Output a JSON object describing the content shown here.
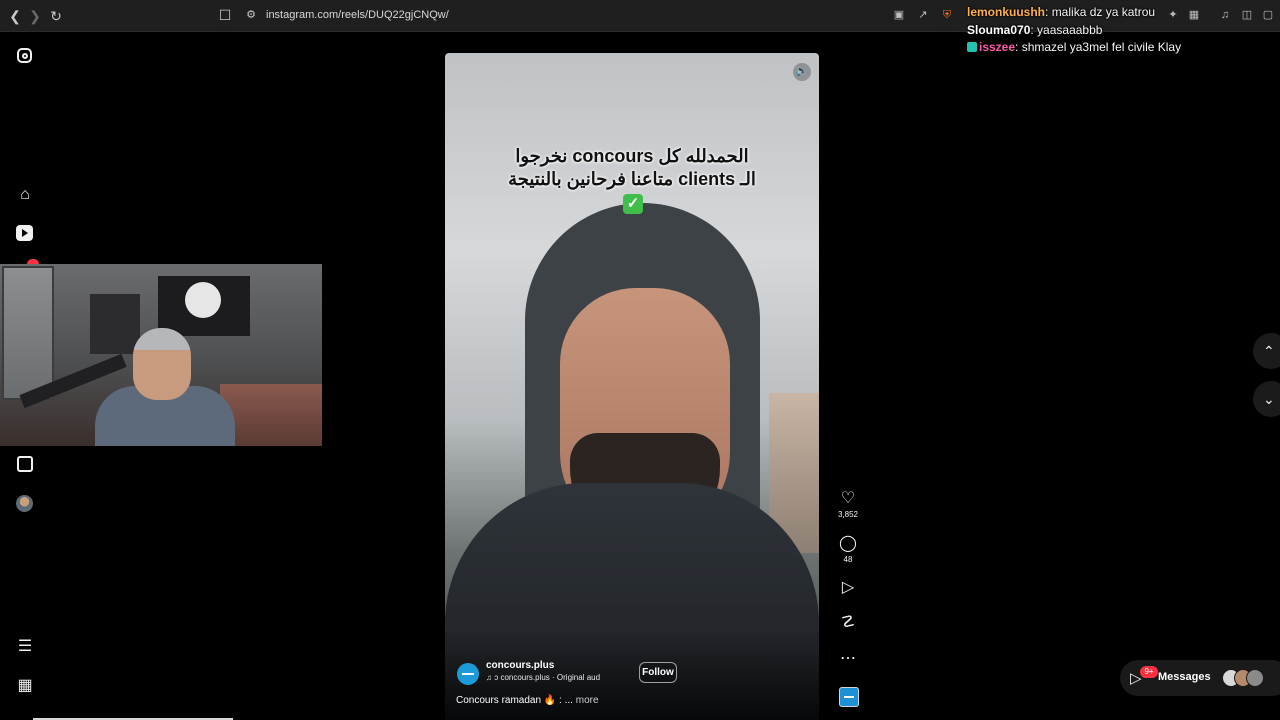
{
  "browser": {
    "url": "instagram.com/reels/DUQ22gjCNQw/",
    "back_icon": "chevron-left-icon",
    "forward_icon": "chevron-right-icon",
    "reload_icon": "reload-icon"
  },
  "chat": [
    {
      "user": "lemonkuushh",
      "color": "#ffb14a",
      "text": "malika dz ya katrou"
    },
    {
      "user": "Slouma070",
      "color": "#ffffff",
      "text": "yaasaaabbb"
    },
    {
      "user": "isszee",
      "color": "#ff5aa8",
      "text": "shmazel ya3mel fel civile Klay"
    }
  ],
  "reel": {
    "caption_line1": "الحمدلله كل concours نخرجوا",
    "caption_line2": "الـ clients متاعنا فرحانين بالنتيجة",
    "checkmark": "✓",
    "account": "concours.plus",
    "audio": "♫ ↄ   concours.plus · Original aud",
    "follow": "Follow",
    "description": "Concours ramadan 🔥 : ...",
    "more": "more"
  },
  "actions": {
    "likes": "3,852",
    "comments": "48"
  },
  "messages": {
    "label": "Messages",
    "badge": "9+"
  },
  "colors": {
    "background": "#000000",
    "notification": "#ff3040",
    "accent": "#1d9bd8"
  }
}
